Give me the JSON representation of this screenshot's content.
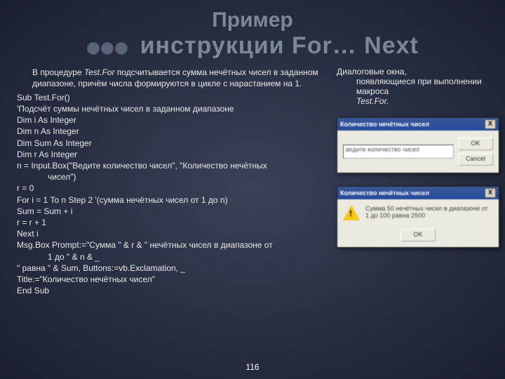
{
  "title": {
    "line1": "Пример",
    "line2_prefix": "инструкции",
    "line2_kw": "For… Next"
  },
  "left": {
    "p1_a": "В процедуре ",
    "p1_proc": "Test.For",
    "p1_b": " подсчитывается сумма нечётных чисел в заданном диапазоне, причём числа формируются в цикле с нарастанием на 1.",
    "l1": "Sub Test.For()",
    "l2": "'Подсчёт суммы нечётных чисел в заданном диапазоне",
    "l3": "Dim i As Integer",
    "l4": "Dim n As Integer",
    "l5": "Dim Sum As Integer",
    "l6": "Dim r As Integer",
    "l7a": "n = Input.Box(\"Ведите количество чисел\", \"Количество нечётных",
    "l7b": "чисел\")",
    "l8": " r = 0",
    "l9": "For i = 1 To n Step 2 '(сумма нечётных чисел от 1 до n)",
    "l10": "Sum = Sum + i",
    "l11": "r = r + 1",
    "l12": "Next i",
    "l13a": "Msg.Box Prompt:=\"Сумма \" & r & \" нечётных чисел в диапазоне от",
    "l13b": "1 до \" & n & _",
    "l14": "\" равна \" & Sum, Buttons:=vb.Exclamation, _",
    "l15": "Title:=\"Количество нечётных чисел\"",
    "l16": "End Sub"
  },
  "right": {
    "note_a": "Диалоговые окна,",
    "note_b": "появляющиеся при выполнении макроса",
    "note_proc": "Test.For.",
    "dlg1": {
      "title": "Количество нечётных чисел",
      "placeholder": "ведите количество чисел",
      "ok": "OK",
      "cancel": "Cancel",
      "x": "X"
    },
    "dlg2": {
      "title": "Количество нечётных чисел",
      "msg": "Сумма 50 нечётных чисел в диапазоне от 1 до 100 равна 2500",
      "ok": "OK",
      "x": "X"
    }
  },
  "page": "116"
}
